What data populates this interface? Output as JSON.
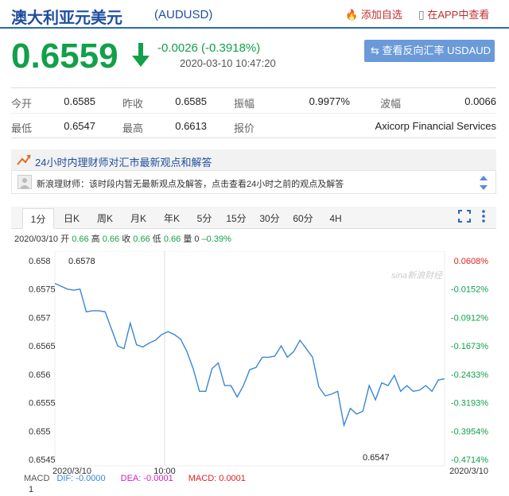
{
  "header": {
    "title": "澳大利亚元美元",
    "code": "(AUDUSD)",
    "fav_label": "添加自选",
    "app_label": "在APP中查看"
  },
  "quote": {
    "price": "0.6559",
    "change": "-0.0026 (-0.3918%)",
    "timestamp": "2020-03-10 10:47:20",
    "reverse_button": "查看反向汇率 USDAUD",
    "direction": "down",
    "color": "#12a04a"
  },
  "stats": [
    {
      "label": "今开",
      "value": "0.6585"
    },
    {
      "label": "昨收",
      "value": "0.6585"
    },
    {
      "label": "振幅",
      "value": "0.9977%"
    },
    {
      "label": "波幅",
      "value": "0.0066"
    },
    {
      "label": "最低",
      "value": "0.6547"
    },
    {
      "label": "最高",
      "value": "0.6613"
    },
    {
      "label": "报价",
      "value": "Axicorp Financial Services"
    }
  ],
  "advisor": {
    "title": "24小时内理财师对汇市最新观点和解答",
    "message": "新浪理财师：该时段内暂无最新观点及解答，点击查看24小时之前的观点及解答"
  },
  "tabs": [
    "1分",
    "日K",
    "周K",
    "月K",
    "年K",
    "5分",
    "15分",
    "30分",
    "60分",
    "4H"
  ],
  "ohlc": {
    "date": "2020/03/10",
    "open_label": "开",
    "open": "0.66",
    "high_label": "高",
    "high": "0.66",
    "close_label": "收",
    "close": "0.66",
    "low_label": "低",
    "low": "0.66",
    "vol_label": "量",
    "vol": "0",
    "chg": "–0.39%"
  },
  "macd": {
    "name": "MACD",
    "dif": "DIF: -0.0000",
    "dea": "DEA: -0.0001",
    "macd": "MACD: 0.0001",
    "tick": "1"
  },
  "watermark": "sina新浪财经",
  "chart_data": {
    "type": "line",
    "y_ticks": [
      "0.658",
      "0.6575",
      "0.657",
      "0.6565",
      "0.656",
      "0.6555",
      "0.655",
      "0.6545"
    ],
    "pct_ticks": [
      "0.0608%",
      "-0.0152%",
      "-0.0912%",
      "-0.1673%",
      "-0.2433%",
      "-0.3193%",
      "-0.3954%",
      "-0.4714%"
    ],
    "x_labels": [
      "2020/3/10",
      "10:00",
      "2020/3/10"
    ],
    "ylim": [
      0.6545,
      0.658
    ],
    "max_label": "0.6578",
    "min_label": "0.6547",
    "values": [
      0.6576,
      0.65755,
      0.6575,
      0.65748,
      0.6575,
      0.6571,
      0.65712,
      0.65712,
      0.6571,
      0.6568,
      0.6565,
      0.65645,
      0.6569,
      0.65652,
      0.65648,
      0.65655,
      0.6566,
      0.6567,
      0.65675,
      0.6567,
      0.65662,
      0.6564,
      0.6561,
      0.6557,
      0.6557,
      0.6561,
      0.6562,
      0.6558,
      0.6558,
      0.6556,
      0.6558,
      0.65608,
      0.65612,
      0.6563,
      0.6563,
      0.65632,
      0.6565,
      0.6563,
      0.6564,
      0.6566,
      0.65645,
      0.6563,
      0.65578,
      0.65562,
      0.65565,
      0.6557,
      0.6551,
      0.6554,
      0.6553,
      0.65535,
      0.6558,
      0.65555,
      0.65585,
      0.6558,
      0.65598,
      0.6557,
      0.6558,
      0.6557,
      0.65572,
      0.6558,
      0.6557,
      0.6559,
      0.65592
    ]
  },
  "colors": {
    "line": "#3a86d4",
    "red": "#e02020",
    "green": "#12a04a",
    "blue": "#1f4e9e"
  }
}
